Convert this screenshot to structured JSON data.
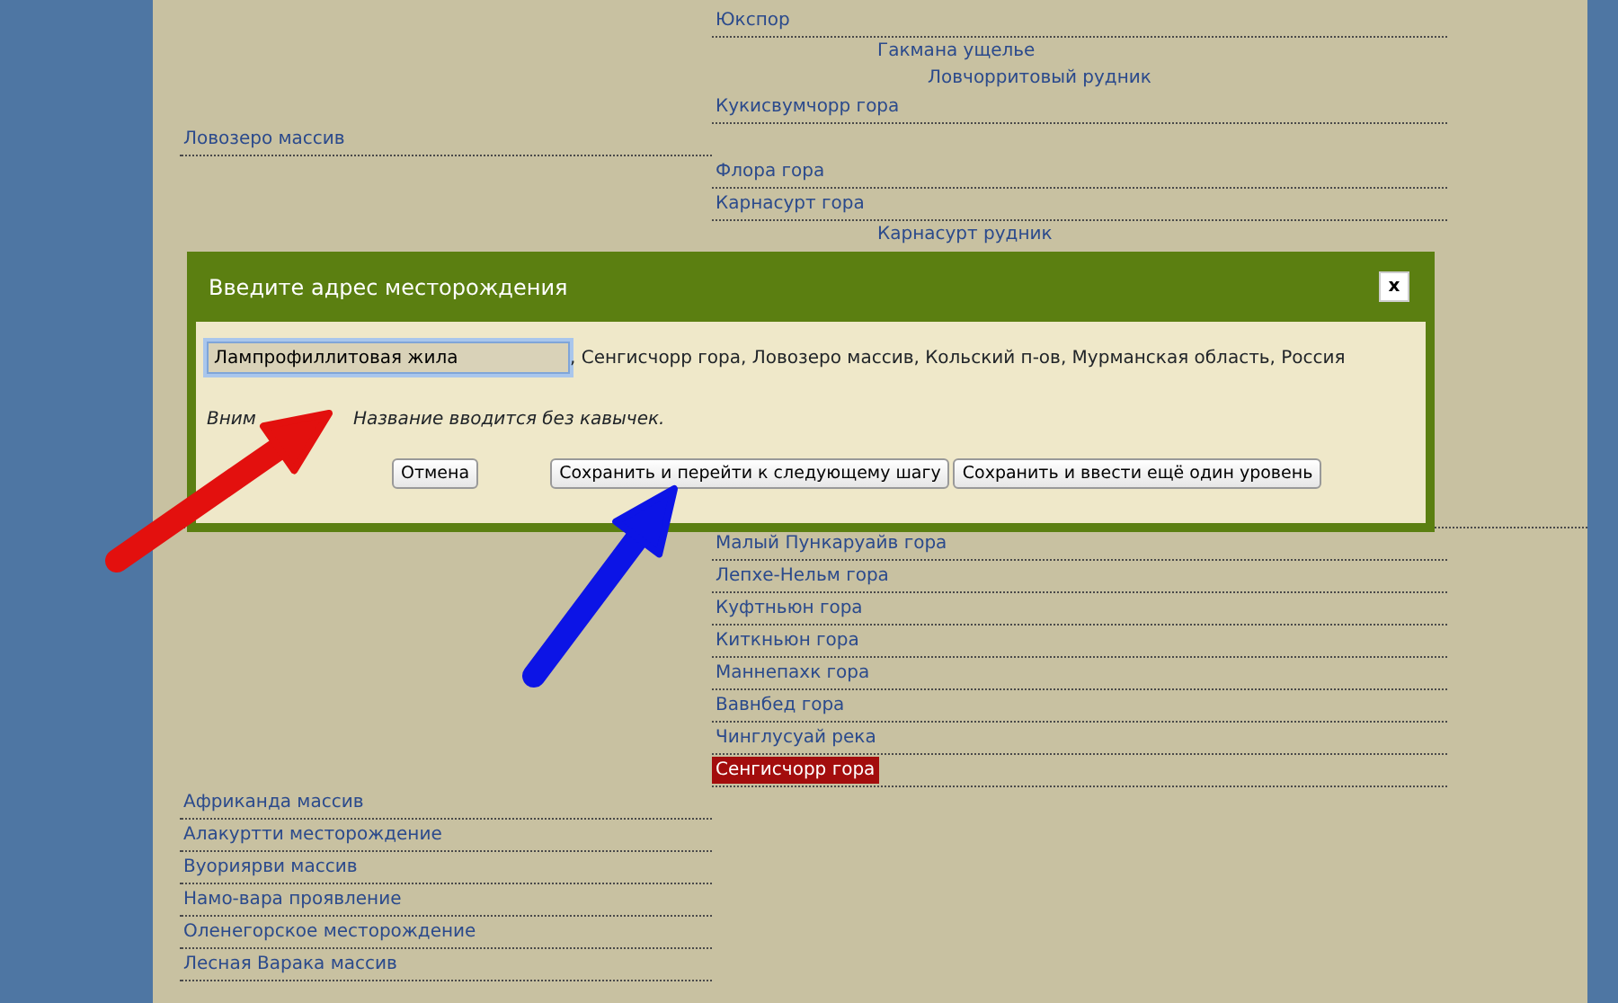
{
  "tree": [
    {
      "kind": "item",
      "label": "Ловозеро массив",
      "selected": false,
      "children_before": [
        {
          "kind": "item",
          "label": "Юкспор",
          "selected": false,
          "children": [
            {
              "kind": "item",
              "label": "Гакмана ущелье",
              "selected": false,
              "children": [
                {
                  "kind": "item",
                  "label": "Ловчорритовый рудник",
                  "selected": false
                }
              ]
            }
          ]
        },
        {
          "kind": "item",
          "label": "Кукисвумчорр гора",
          "selected": false
        }
      ],
      "children": [
        {
          "kind": "item",
          "label": "Флора гора",
          "selected": false
        },
        {
          "kind": "item",
          "label": "Карнасурт гора",
          "selected": false,
          "children": [
            {
              "kind": "item",
              "label": "Карнасурт рудник",
              "selected": false
            }
          ]
        },
        {
          "kind": "covered"
        },
        {
          "kind": "item",
          "label": "Малый Пункаруайв гора",
          "selected": false
        },
        {
          "kind": "item",
          "label": "Лепхе-Нельм гора",
          "selected": false
        },
        {
          "kind": "item",
          "label": "Куфтньюн гора",
          "selected": false
        },
        {
          "kind": "item",
          "label": "Киткньюн гора",
          "selected": false
        },
        {
          "kind": "item",
          "label": "Маннепахк гора",
          "selected": false
        },
        {
          "kind": "item",
          "label": "Вавнбед гора",
          "selected": false
        },
        {
          "kind": "item",
          "label": "Чинглусуай река",
          "selected": false
        },
        {
          "kind": "item",
          "label": "Сенгисчорр гора",
          "selected": true
        }
      ]
    },
    {
      "kind": "item",
      "label": "Африканда массив",
      "selected": false
    },
    {
      "kind": "item",
      "label": "Алакуртти месторождение",
      "selected": false
    },
    {
      "kind": "item",
      "label": "Вуориярви массив",
      "selected": false
    },
    {
      "kind": "item",
      "label": "Намо-вара проявление",
      "selected": false
    },
    {
      "kind": "item",
      "label": "Оленегорское месторождение",
      "selected": false
    },
    {
      "kind": "item",
      "label": "Лесная Варака массив",
      "selected": false
    }
  ],
  "dialog": {
    "title": "Введите адрес месторождения",
    "close": "x",
    "address_input": {
      "value": "Лампрофиллитовая жила"
    },
    "address_rest": ", Сенгисчорр гора, Ловозеро массив, Кольский п-ов, Мурманская область, Россия",
    "warning_parts": [
      "Вним",
      "Название вводится без кавычек."
    ],
    "buttons": [
      "Отмена",
      "Сохранить и перейти к следующему шагу",
      "Сохранить и ввести ещё один уровень"
    ]
  }
}
